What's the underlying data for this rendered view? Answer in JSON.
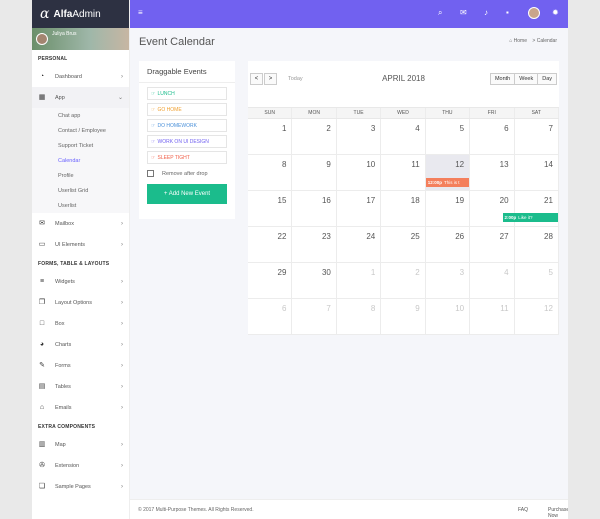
{
  "brand": {
    "mark": "α",
    "bold": "Alfa",
    "light": "Admin"
  },
  "user": {
    "name": "Juliya Brus"
  },
  "sidebar": {
    "sections": [
      "PERSONAL",
      "FORMS, TABLE & LAYOUTS",
      "EXTRA COMPONENTS"
    ],
    "dashboard": "Dashboard",
    "app": "App",
    "app_sub": [
      "Chat app",
      "Contact / Employee",
      "Support Ticket",
      "Calendar",
      "Profile",
      "Userlist Grid",
      "Userlist"
    ],
    "mailbox": "Mailbox",
    "ui_elements": "UI Elements",
    "widgets": "Widgets",
    "layout_options": "Layout Options",
    "box": "Box",
    "charts": "Charts",
    "forms": "Forms",
    "tables": "Tables",
    "emails": "Emails",
    "map": "Map",
    "extension": "Extension",
    "sample_pages": "Sample Pages"
  },
  "topbar": {
    "menu_icon": "≡",
    "search_icon": "⌕",
    "mail_icon": "✉",
    "bell_icon": "♪",
    "chat_icon": "▪",
    "settings_icon": "✹"
  },
  "page": {
    "title": "Event Calendar",
    "crumb_home": "Home",
    "crumb_sep": ">",
    "crumb_current": "Calendar"
  },
  "draggable": {
    "title": "Draggable Events",
    "events": [
      {
        "label": "LUNCH",
        "color": "#1bbc8c"
      },
      {
        "label": "GO HOME",
        "color": "#f0a030"
      },
      {
        "label": "DO HOMEWORK",
        "color": "#4a90d9"
      },
      {
        "label": "WORK ON UI DESIGN",
        "color": "#7161f0"
      },
      {
        "label": "SLEEP TIGHT",
        "color": "#f0604a"
      }
    ],
    "hand": "☞",
    "remove_label": "Remove after drop",
    "add_button": "+ Add New Event"
  },
  "calendar": {
    "prev": "<",
    "next": ">",
    "today": "Today",
    "month": "APRIL 2018",
    "views": [
      "Month",
      "Week",
      "Day"
    ],
    "dow": [
      "SUN",
      "MON",
      "TUE",
      "WED",
      "THU",
      "FRI",
      "SAT"
    ],
    "weeks": [
      [
        "",
        "1",
        "2",
        "3",
        "4",
        "5",
        "6",
        "7"
      ],
      [
        "8",
        "9",
        "10",
        "11",
        "12",
        "13",
        "14"
      ],
      [
        "15",
        "16",
        "17",
        "18",
        "19",
        "20",
        "21"
      ],
      [
        "22",
        "23",
        "24",
        "25",
        "26",
        "27",
        "28"
      ],
      [
        "29",
        "30",
        "1",
        "2",
        "3",
        "4",
        "5"
      ],
      [
        "6",
        "7",
        "8",
        "9",
        "10",
        "11",
        "12"
      ]
    ],
    "events": [
      {
        "time": "12:00p",
        "title": "This is t",
        "color": "#f47f5c"
      },
      {
        "time": "2:00p",
        "title": "Like it?",
        "color": "#1bbc8c"
      }
    ]
  },
  "footer": {
    "copyright": "© 2017 Multi-Purpose Themes. All Rights Reserved.",
    "faq": "FAQ",
    "purchase": "Purchase Now"
  }
}
